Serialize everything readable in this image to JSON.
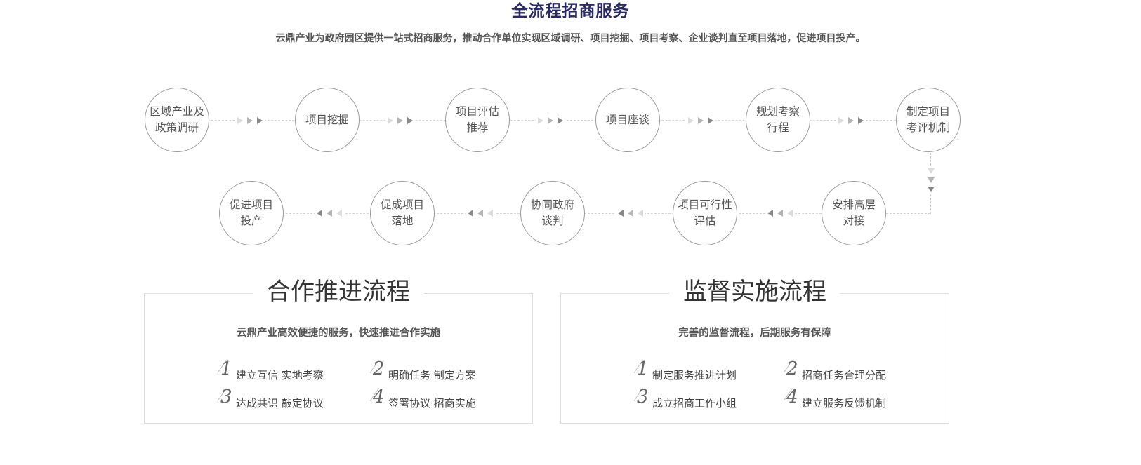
{
  "header": {
    "title": "全流程招商服务",
    "subtitle": "云鼎产业为政府园区提供一站式招商服务，推动合作单位实现区域调研、项目挖掘、项目考察、企业谈判直至项目落地，促进项目投产。"
  },
  "flow": {
    "row1": [
      {
        "line1": "区域产业及",
        "line2": "政策调研"
      },
      {
        "line1": "项目挖掘",
        "line2": ""
      },
      {
        "line1": "项目评估",
        "line2": "推荐"
      },
      {
        "line1": "项目座谈",
        "line2": ""
      },
      {
        "line1": "规划考察",
        "line2": "行程"
      },
      {
        "line1": "制定项目",
        "line2": "考评机制"
      }
    ],
    "row2": [
      {
        "line1": "促进项目",
        "line2": "投产"
      },
      {
        "line1": "促成项目",
        "line2": "落地"
      },
      {
        "line1": "协同政府",
        "line2": "谈判"
      },
      {
        "line1": "项目可行性",
        "line2": "评估"
      },
      {
        "line1": "安排高层",
        "line2": "对接"
      }
    ],
    "arrow_colors": [
      "#dcdcdc",
      "#b4b4b4",
      "#888888"
    ]
  },
  "cooperation": {
    "title": "合作推进流程",
    "subtitle": "云鼎产业高效便捷的服务，快速推进合作实施",
    "items": [
      {
        "num": "1",
        "text": "建立互信 实地考察"
      },
      {
        "num": "2",
        "text": "明确任务 制定方案"
      },
      {
        "num": "3",
        "text": "达成共识 敲定协议"
      },
      {
        "num": "4",
        "text": "签署协议 招商实施"
      }
    ]
  },
  "supervision": {
    "title": "监督实施流程",
    "subtitle": "完善的监督流程，后期服务有保障",
    "items": [
      {
        "num": "1",
        "text": "制定服务推进计划"
      },
      {
        "num": "2",
        "text": "招商任务合理分配"
      },
      {
        "num": "3",
        "text": "成立招商工作小组"
      },
      {
        "num": "4",
        "text": "建立服务反馈机制"
      }
    ]
  }
}
